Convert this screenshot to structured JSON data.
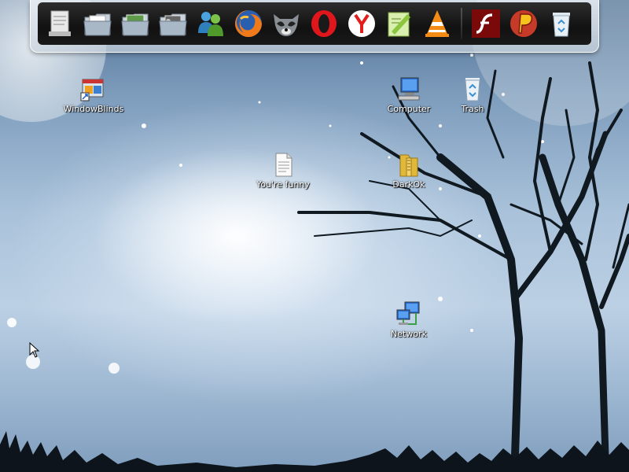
{
  "dock": {
    "items": [
      {
        "name": "notes-app-icon"
      },
      {
        "name": "folder-icon"
      },
      {
        "name": "images-folder-icon"
      },
      {
        "name": "media-folder-icon"
      },
      {
        "name": "messenger-icon"
      },
      {
        "name": "firefox-icon"
      },
      {
        "name": "raccoon-app-icon"
      },
      {
        "name": "opera-icon"
      },
      {
        "name": "yandex-browser-icon"
      },
      {
        "name": "notepad-plus-icon"
      },
      {
        "name": "vlc-icon"
      },
      {
        "name": "flash-player-icon"
      },
      {
        "name": "p-app-icon"
      },
      {
        "name": "recycle-bin-icon"
      }
    ],
    "colors": {
      "bar": "#1a1a1a",
      "frame": "#e6ebf0"
    }
  },
  "desktop": {
    "icons": {
      "windowblinds": "WindowBlinds",
      "computer": "Computer",
      "trash": "Trash",
      "text_file": "You're funny",
      "folder": "DarkOk",
      "network": "Network"
    }
  }
}
